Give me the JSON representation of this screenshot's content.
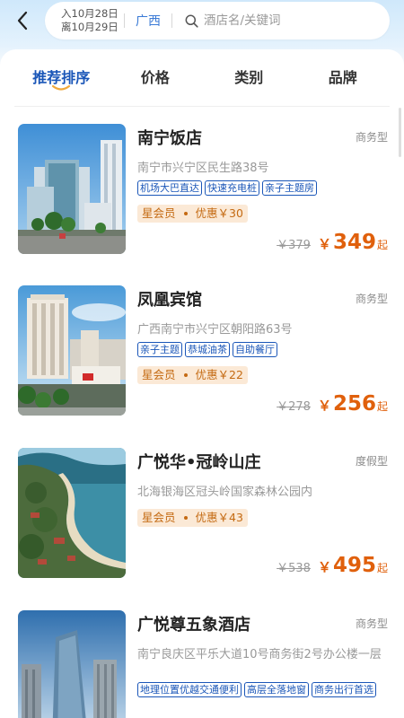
{
  "header": {
    "checkin": "入10月28日",
    "checkout": "离10月29日",
    "city": "广西",
    "search_placeholder": "酒店名/关键词"
  },
  "sort_tabs": [
    {
      "label": "推荐排序",
      "active": true
    },
    {
      "label": "价格",
      "active": false
    },
    {
      "label": "类别",
      "active": false
    },
    {
      "label": "品牌",
      "active": false
    }
  ],
  "hotels": [
    {
      "name": "南宁饭店",
      "type": "商务型",
      "address": "南宁市兴宁区民生路38号",
      "tags": [
        "机场大巴直达",
        "快速充电桩",
        "亲子主题房"
      ],
      "member_label": "星会员",
      "discount": "优惠￥30",
      "original_price": "￥379",
      "currency": "￥",
      "price": "349",
      "price_suffix": "起"
    },
    {
      "name": "凤凰宾馆",
      "type": "商务型",
      "address": "广西南宁市兴宁区朝阳路63号",
      "tags": [
        "亲子主题",
        "恭城油茶",
        "自助餐厅"
      ],
      "member_label": "星会员",
      "discount": "优惠￥22",
      "original_price": "￥278",
      "currency": "￥",
      "price": "256",
      "price_suffix": "起"
    },
    {
      "name": "广悦华•冠岭山庄",
      "type": "度假型",
      "address": "北海银海区冠头岭国家森林公园内",
      "tags": [],
      "member_label": "星会员",
      "discount": "优惠￥43",
      "original_price": "￥538",
      "currency": "￥",
      "price": "495",
      "price_suffix": "起"
    },
    {
      "name": "广悦尊五象酒店",
      "type": "商务型",
      "address": "南宁良庆区平乐大道10号商务街2号办公楼一层",
      "tags": [
        "地理位置优越交通便利",
        "高层全落地窗",
        "商务出行首选"
      ],
      "member_label": "",
      "discount": "",
      "original_price": "",
      "currency": "",
      "price": "",
      "price_suffix": ""
    }
  ],
  "colors": {
    "accent_blue": "#1a56b8",
    "price_orange": "#e0600c",
    "member_bg": "#fbe9d6"
  },
  "icons": {
    "back": "chevron-left-icon",
    "search": "search-icon",
    "tab_underline": "smile-underline-icon"
  }
}
